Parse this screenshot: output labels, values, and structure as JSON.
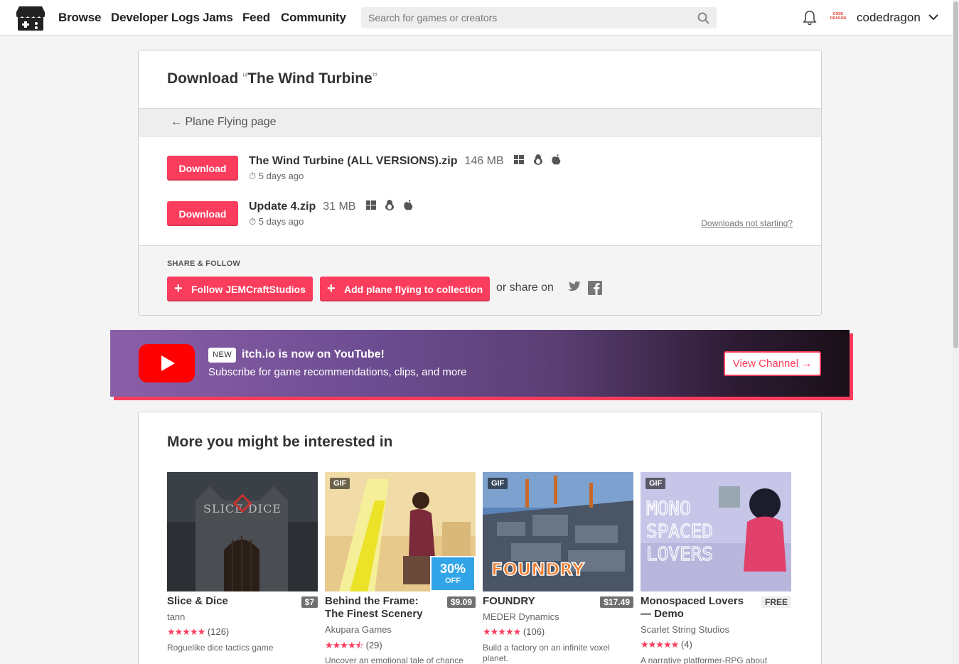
{
  "header": {
    "nav": [
      "Browse",
      "Developer Logs",
      "Jams",
      "Feed",
      "Community"
    ],
    "search_placeholder": "Search for games or creators",
    "username": "codedragon",
    "avatar_text": "CODE DRAGON"
  },
  "download": {
    "title_prefix": "Download",
    "game_title": "The Wind Turbine",
    "back_link": "Plane Flying page",
    "button_label": "Download",
    "files": [
      {
        "name": "The Wind Turbine (ALL VERSIONS).zip",
        "size": "146 MB",
        "date": "5 days ago",
        "platforms": [
          "windows-icon",
          "linux-icon",
          "apple-icon"
        ]
      },
      {
        "name": "Update 4.zip",
        "size": "31 MB",
        "date": "5 days ago",
        "platforms": [
          "windows-icon",
          "linux-icon",
          "apple-icon"
        ]
      }
    ],
    "help_link": "Downloads not starting?",
    "share_label": "SHARE & FOLLOW",
    "follow_button": "Follow JEMCraftStudios",
    "collection_button": "Add plane flying to collection",
    "share_on": "or share on"
  },
  "youtube": {
    "badge": "NEW",
    "title": "itch.io is now on YouTube!",
    "subtitle": "Subscribe for game recommendations, clips, and more",
    "button": "View Channel →"
  },
  "recs": {
    "title": "More you might be interested in",
    "games": [
      {
        "title": "Slice & Dice",
        "author": "tann",
        "price": "$7",
        "rating": 5,
        "reviews": "(126)",
        "desc": "Roguelike dice tactics game",
        "gif": "",
        "sale": null
      },
      {
        "title": "Behind the Frame: The Finest Scenery",
        "author": "Akupara Games",
        "price": "$9.09",
        "rating": 4.5,
        "reviews": "(29)",
        "desc": "Uncover an emotional tale of chance",
        "gif": "GIF",
        "sale": {
          "pct": "30%",
          "off": "OFF"
        }
      },
      {
        "title": "FOUNDRY",
        "author": "MEDER Dynamics",
        "price": "$17.49",
        "rating": 5,
        "reviews": "(106)",
        "desc": "Build a factory on an infinite voxel planet.",
        "gif": "GIF",
        "sale": null
      },
      {
        "title": "Monospaced Lovers — Demo",
        "author": "Scarlet String Studios",
        "price": "FREE",
        "rating": 5,
        "reviews": "(4)",
        "desc": "A narrative platformer-RPG about",
        "gif": "GIF",
        "sale": null
      }
    ]
  },
  "colors": {
    "accent": "#fa3d5c",
    "sale": "#32a4e8",
    "youtube": "#ff0000"
  }
}
